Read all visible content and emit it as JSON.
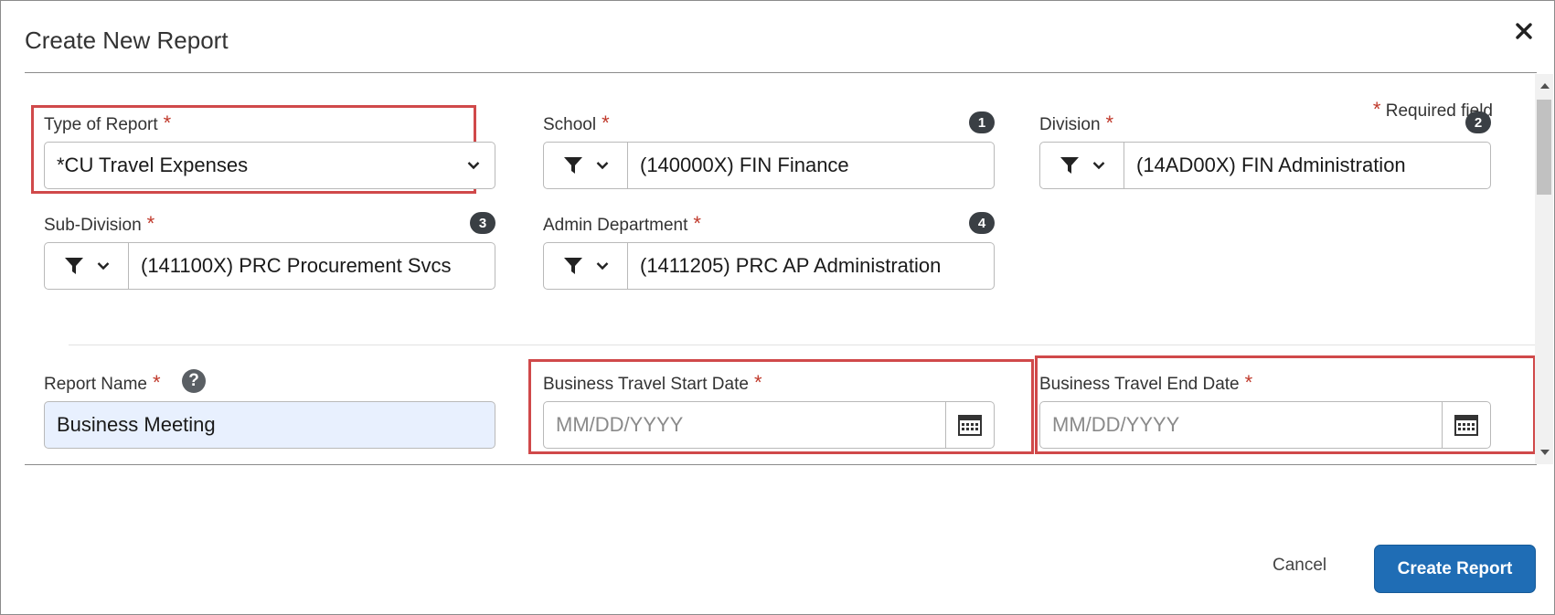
{
  "dialog": {
    "title": "Create New Report",
    "close_glyph": "✕"
  },
  "form": {
    "required_note": "Required field",
    "required_mark": "*",
    "type_of_report": {
      "label": "Type of Report",
      "value": "*CU Travel Expenses"
    },
    "school": {
      "label": "School",
      "badge": "1",
      "value": "(140000X) FIN Finance"
    },
    "division": {
      "label": "Division",
      "badge": "2",
      "value": "(14AD00X) FIN Administration"
    },
    "sub_division": {
      "label": "Sub-Division",
      "badge": "3",
      "value": "(141100X) PRC Procurement Svcs"
    },
    "admin_department": {
      "label": "Admin Department",
      "badge": "4",
      "value": "(1411205) PRC AP Administration"
    },
    "report_name": {
      "label": "Report Name",
      "help": "?",
      "value": "Business Meeting"
    },
    "start_date": {
      "label": "Business Travel Start Date",
      "placeholder": "MM/DD/YYYY"
    },
    "end_date": {
      "label": "Business Travel End Date",
      "placeholder": "MM/DD/YYYY"
    }
  },
  "footer": {
    "cancel_label": "Cancel",
    "create_label": "Create Report"
  },
  "colors": {
    "primary_button": "#1f6db5",
    "required_star": "#c0392b",
    "highlight_box": "#d0494a",
    "badge_bg": "#3a3f44"
  },
  "icons": [
    "close-icon",
    "chevron-down-icon",
    "filter-icon",
    "calendar-icon",
    "help-icon"
  ]
}
